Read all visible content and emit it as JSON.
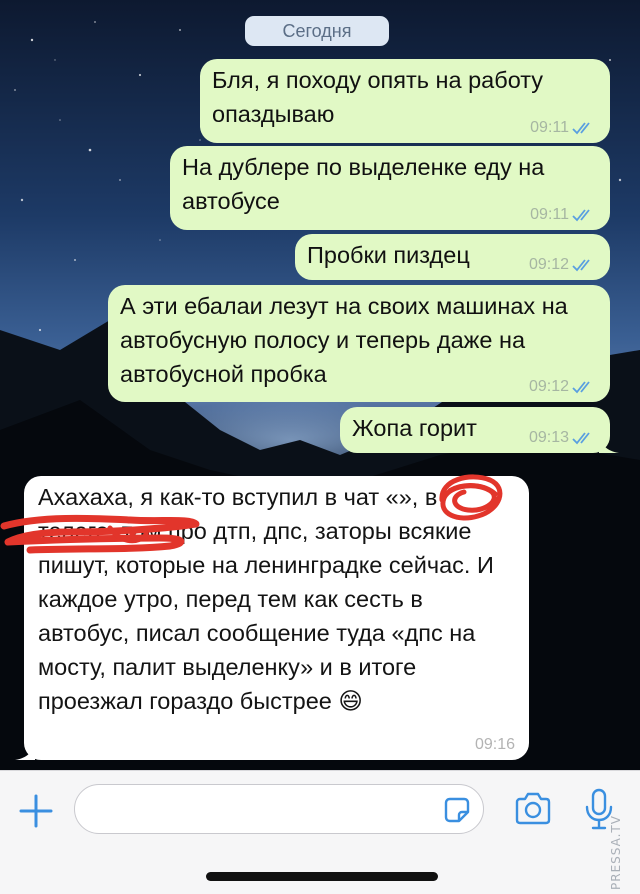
{
  "chat": {
    "date_label": "Сегодня",
    "messages": [
      {
        "direction": "outgoing",
        "text": "Бля, я походу опять на работу опаздываю",
        "time": "09:11",
        "status": "read"
      },
      {
        "direction": "outgoing",
        "text": "На дублере по выделенке еду на автобусе",
        "time": "09:11",
        "status": "read"
      },
      {
        "direction": "outgoing",
        "text": "Пробки пиздец",
        "time": "09:12",
        "status": "read"
      },
      {
        "direction": "outgoing",
        "text": "А эти ебалаи лезут на своих машинах на автобусную полосу и теперь даже на автобусной пробка",
        "time": "09:12",
        "status": "read"
      },
      {
        "direction": "outgoing",
        "text": "Жопа горит",
        "time": "09:13",
        "status": "read"
      },
      {
        "direction": "incoming",
        "text": "Ахахаха, я как-то вступил в чат «», в телеге, там про дтп, дпс, заторы всякие пишут, которые на ленинградке сейчас. И каждое утро, перед тем как сесть в автобус, писал сообщение туда «дпс на мосту, палит выделенку» и в итоге проезжал гораздо быстрее 😄",
        "time": "09:16"
      }
    ]
  },
  "composer": {
    "placeholder": "",
    "value": ""
  },
  "icons": {
    "attach": "plus-icon",
    "sticker": "sticker-icon",
    "camera": "camera-icon",
    "voice": "microphone-icon",
    "read_receipt": "double-check-icon"
  },
  "colors": {
    "outgoing_bubble": "#e1f9c5",
    "incoming_bubble": "#ffffff",
    "accent": "#3a8fe0",
    "scribble": "#e2352b"
  },
  "watermark": "PRESSA.TV"
}
